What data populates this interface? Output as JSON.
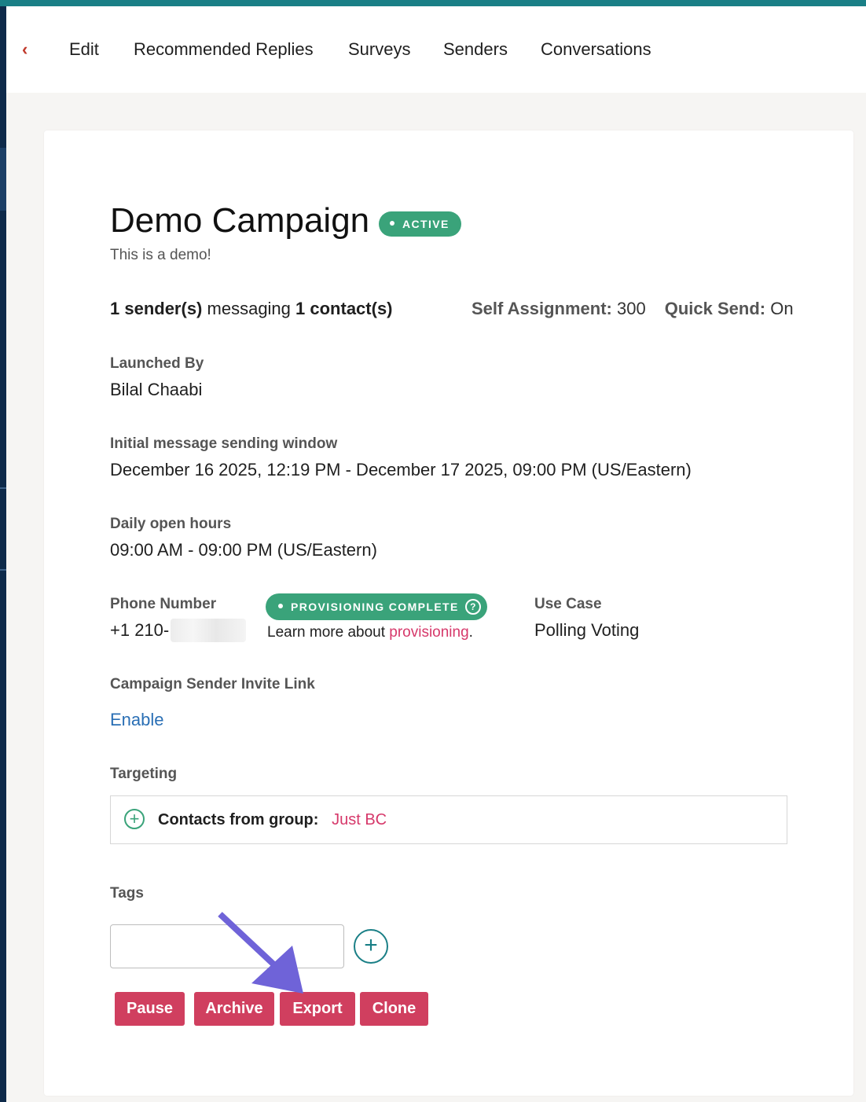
{
  "nav": {
    "back_icon": "chevron-left-icon",
    "tabs": [
      "Edit",
      "Recommended Replies",
      "Surveys",
      "Senders",
      "Conversations"
    ]
  },
  "campaign": {
    "title": "Demo Campaign",
    "status": "ACTIVE",
    "description": "This is a demo!",
    "summary": {
      "senders": "1 sender(s)",
      "messaging": "messaging",
      "contacts": "1 contact(s)"
    },
    "self_assignment_label": "Self Assignment:",
    "self_assignment_value": "300",
    "quick_send_label": "Quick Send:",
    "quick_send_value": "On",
    "launched_by_label": "Launched By",
    "launched_by": "Bilal Chaabi",
    "sending_window_label": "Initial message sending window",
    "sending_window": "December 16 2025, 12:19 PM - December 17 2025, 09:00 PM (US/Eastern)",
    "open_hours_label": "Daily open hours",
    "open_hours": "09:00 AM - 09:00 PM (US/Eastern)",
    "phone_label": "Phone Number",
    "phone_prefix": "+1 210-",
    "provisioning_status": "PROVISIONING COMPLETE",
    "learn_more_text": "Learn more about ",
    "learn_more_link": "provisioning",
    "learn_more_end": ".",
    "use_case_label": "Use Case",
    "use_case": "Polling Voting",
    "invite_link_label": "Campaign Sender Invite Link",
    "invite_link_action": "Enable",
    "targeting_label": "Targeting",
    "targeting_prefix": "Contacts from group:",
    "targeting_group": "Just BC",
    "tags_label": "Tags",
    "tags_input_value": ""
  },
  "actions": {
    "pause": "Pause",
    "archive": "Archive",
    "export": "Export",
    "clone": "Clone"
  },
  "colors": {
    "accent_teal": "#1a7f86",
    "status_green": "#3aa37a",
    "action_red": "#d03f5f",
    "link_pink": "#d6386a",
    "link_blue": "#2a6fb5",
    "annotation_arrow": "#6f63d8"
  }
}
